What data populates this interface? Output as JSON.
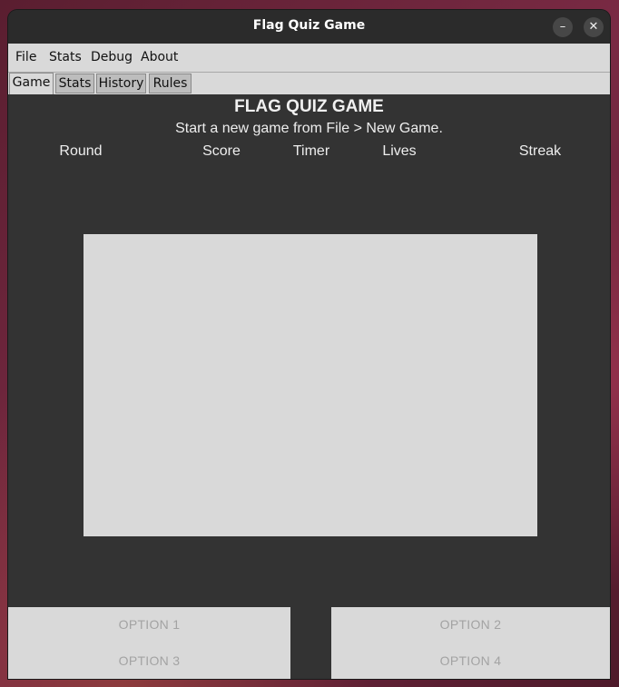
{
  "window": {
    "title": "Flag Quiz Game",
    "minimize_glyph": "–",
    "close_glyph": "✕"
  },
  "menu": {
    "items": [
      {
        "label": "File"
      },
      {
        "label": "Stats"
      },
      {
        "label": "Debug"
      },
      {
        "label": "About"
      }
    ]
  },
  "tabs": [
    {
      "label": "Game",
      "active": true
    },
    {
      "label": "Stats",
      "active": false
    },
    {
      "label": "History",
      "active": false
    },
    {
      "label": "Rules",
      "active": false
    }
  ],
  "game": {
    "title": "FLAG QUIZ GAME",
    "status": "Start a new game from File > New Game.",
    "stats": {
      "round": "Round",
      "score": "Score",
      "timer": "Timer",
      "lives": "Lives",
      "streak": "Streak"
    },
    "options": [
      {
        "label": "OPTION 1"
      },
      {
        "label": "OPTION 2"
      },
      {
        "label": "OPTION 3"
      },
      {
        "label": "OPTION 4"
      }
    ]
  },
  "colors": {
    "window_bg": "#333333",
    "titlebar_bg": "#2b2b2b",
    "menu_bg": "#d9d9d9",
    "flag_placeholder": "#d9d9d9",
    "option_text_disabled": "#a3a3a3"
  }
}
